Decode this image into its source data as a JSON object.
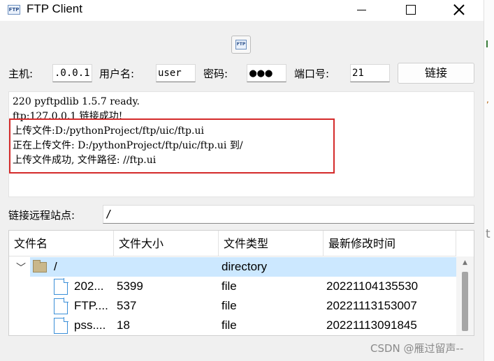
{
  "window": {
    "title": "FTP Client",
    "app_icon_text": "FTP"
  },
  "toolbar": {
    "ftp_icon_text": "FTP"
  },
  "connection": {
    "host_label": "主机:",
    "host_value": ".0.0.1",
    "user_label": "用户名:",
    "user_value": "user",
    "password_label": "密码:",
    "password_value": "●●●",
    "port_label": "端口号:",
    "port_value": "21",
    "connect_button": "链接"
  },
  "log": {
    "lines": [
      "220 pyftpdlib 1.5.7 ready.",
      "ftp:127.0.0.1 链接成功!",
      "上传文件:D:/pythonProject/ftp/uic/ftp.ui",
      "正在上传文件: D:/pythonProject/ftp/uic/ftp.ui 到/",
      "上传文件成功, 文件路径: //ftp.ui"
    ],
    "highlight_color": "#d42a2a"
  },
  "remote": {
    "label": "链接远程站点:",
    "value": "/"
  },
  "tree": {
    "columns": [
      "文件名",
      "文件大小",
      "文件类型",
      "最新修改时间"
    ],
    "root": {
      "name": "/",
      "size": "",
      "type": "directory",
      "modified": "",
      "icon": "folder-icon"
    },
    "files": [
      {
        "name": "202...",
        "size": "5399",
        "type": "file",
        "modified": "20221104135530",
        "icon": "file-icon"
      },
      {
        "name": "FTP....",
        "size": "537",
        "type": "file",
        "modified": "20221113153007",
        "icon": "file-icon"
      },
      {
        "name": "pss....",
        "size": "18",
        "type": "file",
        "modified": "20221113091845",
        "icon": "file-icon"
      }
    ],
    "selection_color": "#cce8ff"
  },
  "watermark": "CSDN @雁过留声--"
}
